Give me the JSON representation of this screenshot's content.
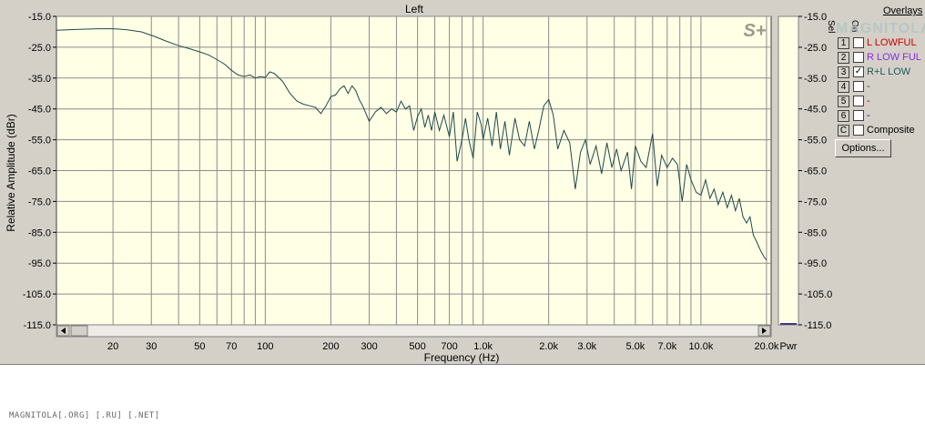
{
  "window": {
    "channel_title": "Left"
  },
  "overlays": {
    "title": "Overlays",
    "col_sel": "Sel",
    "col_on": "On",
    "items": [
      {
        "num": "1",
        "label": "L LOWFUL",
        "checked": false,
        "color": "#cc0000"
      },
      {
        "num": "2",
        "label": "R LOW FUL",
        "checked": false,
        "color": "#8a2be2"
      },
      {
        "num": "3",
        "label": "R+L LOW",
        "checked": true,
        "color": "#1e5a5a"
      },
      {
        "num": "4",
        "label": "-",
        "checked": false,
        "color": "#1e5a5a"
      },
      {
        "num": "5",
        "label": "-",
        "checked": false,
        "color": "#cc0000"
      },
      {
        "num": "6",
        "label": "-",
        "checked": false,
        "color": "#0000cc"
      },
      {
        "num": "C",
        "label": "Composite",
        "checked": false,
        "color": "#000000"
      }
    ],
    "options_label": "Options..."
  },
  "logo": {
    "plot_mark": "S+",
    "overlay_text": "MAGNITOLA"
  },
  "power_meter": {
    "label": "Pwr",
    "y_ticks": [
      "-15.0",
      "-25.0",
      "-35.0",
      "-45.0",
      "-55.0",
      "-65.0",
      "-75.0",
      "-85.0",
      "-95.0",
      "-105.0",
      "-115.0"
    ]
  },
  "footer": {
    "watermark": "MAGNITOLA[.ORG] [.RU] [.NET]"
  },
  "chart_data": {
    "type": "line",
    "title": "Left",
    "xlabel": "Frequency (Hz)",
    "ylabel": "Relative Amplitude (dBr)",
    "x_scale": "log",
    "xlim": [
      11,
      21000
    ],
    "ylim": [
      -115,
      -15
    ],
    "grid": true,
    "x_ticks": [
      {
        "value": 20,
        "label": "20"
      },
      {
        "value": 30,
        "label": "30"
      },
      {
        "value": 50,
        "label": "50"
      },
      {
        "value": 70,
        "label": "70"
      },
      {
        "value": 100,
        "label": "100"
      },
      {
        "value": 200,
        "label": "200"
      },
      {
        "value": 300,
        "label": "300"
      },
      {
        "value": 500,
        "label": "500"
      },
      {
        "value": 700,
        "label": "700"
      },
      {
        "value": 1000,
        "label": "1.0k"
      },
      {
        "value": 2000,
        "label": "2.0k"
      },
      {
        "value": 3000,
        "label": "3.0k"
      },
      {
        "value": 5000,
        "label": "5.0k"
      },
      {
        "value": 7000,
        "label": "7.0k"
      },
      {
        "value": 10000,
        "label": "10.0k"
      },
      {
        "value": 20000,
        "label": "20.0k"
      }
    ],
    "y_ticks": [
      -15,
      -25,
      -35,
      -45,
      -55,
      -65,
      -75,
      -85,
      -95,
      -105,
      -115
    ],
    "y_tick_labels": [
      "-15.0",
      "-25.0",
      "-35.0",
      "-45.0",
      "-55.0",
      "-65.0",
      "-75.0",
      "-85.0",
      "-95.0",
      "-105.0",
      "-115.0"
    ],
    "series": [
      {
        "color": "#1e4a4a",
        "x": [
          11,
          14,
          17,
          20,
          23,
          27,
          31,
          35,
          40,
          45,
          50,
          55,
          60,
          65,
          70,
          75,
          80,
          85,
          90,
          95,
          100,
          105,
          110,
          120,
          130,
          140,
          150,
          160,
          170,
          180,
          190,
          200,
          210,
          220,
          230,
          240,
          250,
          260,
          270,
          280,
          300,
          320,
          340,
          360,
          380,
          400,
          420,
          440,
          460,
          480,
          500,
          520,
          540,
          560,
          580,
          600,
          630,
          660,
          700,
          730,
          760,
          800,
          830,
          860,
          900,
          940,
          980,
          1000,
          1050,
          1100,
          1150,
          1200,
          1260,
          1320,
          1400,
          1470,
          1550,
          1630,
          1720,
          1800,
          1900,
          2000,
          2100,
          2200,
          2350,
          2500,
          2650,
          2800,
          2950,
          3100,
          3300,
          3500,
          3700,
          3900,
          4100,
          4300,
          4600,
          4800,
          5000,
          5300,
          5600,
          6000,
          6300,
          6600,
          7000,
          7400,
          7800,
          8200,
          8600,
          9000,
          9500,
          10000,
          10500,
          11000,
          11500,
          12000,
          12600,
          13200,
          13800,
          14400,
          15000,
          15600,
          16200,
          16800,
          17400,
          18000,
          18800,
          19500,
          20000
        ],
        "y": [
          -19.5,
          -19.2,
          -19.0,
          -19.0,
          -19.3,
          -20.0,
          -21.5,
          -23.0,
          -24.5,
          -25.5,
          -26.5,
          -27.5,
          -29.0,
          -30.5,
          -32.5,
          -34.0,
          -34.5,
          -34.0,
          -35.0,
          -34.5,
          -34.8,
          -33.0,
          -33.5,
          -36.0,
          -40.0,
          -42.5,
          -43.5,
          -44.0,
          -44.5,
          -46.5,
          -44.0,
          -41.0,
          -40.5,
          -38.5,
          -37.5,
          -40.0,
          -37.5,
          -39.0,
          -42.0,
          -44.0,
          -49.0,
          -46.0,
          -44.5,
          -46.5,
          -45.0,
          -46.0,
          -42.5,
          -45.0,
          -44.0,
          -52.0,
          -47.5,
          -45.0,
          -51.0,
          -47.0,
          -52.0,
          -46.0,
          -52.0,
          -47.0,
          -54.0,
          -46.0,
          -62.0,
          -55.0,
          -48.0,
          -55.0,
          -61.0,
          -46.0,
          -50.0,
          -55.0,
          -48.0,
          -57.0,
          -46.0,
          -58.0,
          -49.0,
          -60.0,
          -48.0,
          -55.0,
          -57.0,
          -49.0,
          -58.0,
          -52.0,
          -44.0,
          -42.0,
          -47.0,
          -58.0,
          -52.0,
          -56.0,
          -71.0,
          -59.0,
          -55.0,
          -63.0,
          -57.0,
          -66.0,
          -56.0,
          -64.0,
          -58.0,
          -65.0,
          -59.0,
          -71.0,
          -57.0,
          -62.0,
          -64.0,
          -53.0,
          -70.0,
          -60.0,
          -64.0,
          -61.0,
          -63.0,
          -75.0,
          -63.0,
          -68.0,
          -72.0,
          -73.0,
          -68.0,
          -74.0,
          -71.0,
          -76.0,
          -72.0,
          -77.0,
          -73.0,
          -78.0,
          -74.0,
          -80.0,
          -82.0,
          -80.0,
          -86.0,
          -88.0,
          -91.0,
          -93.0,
          -94.0
        ]
      }
    ]
  }
}
